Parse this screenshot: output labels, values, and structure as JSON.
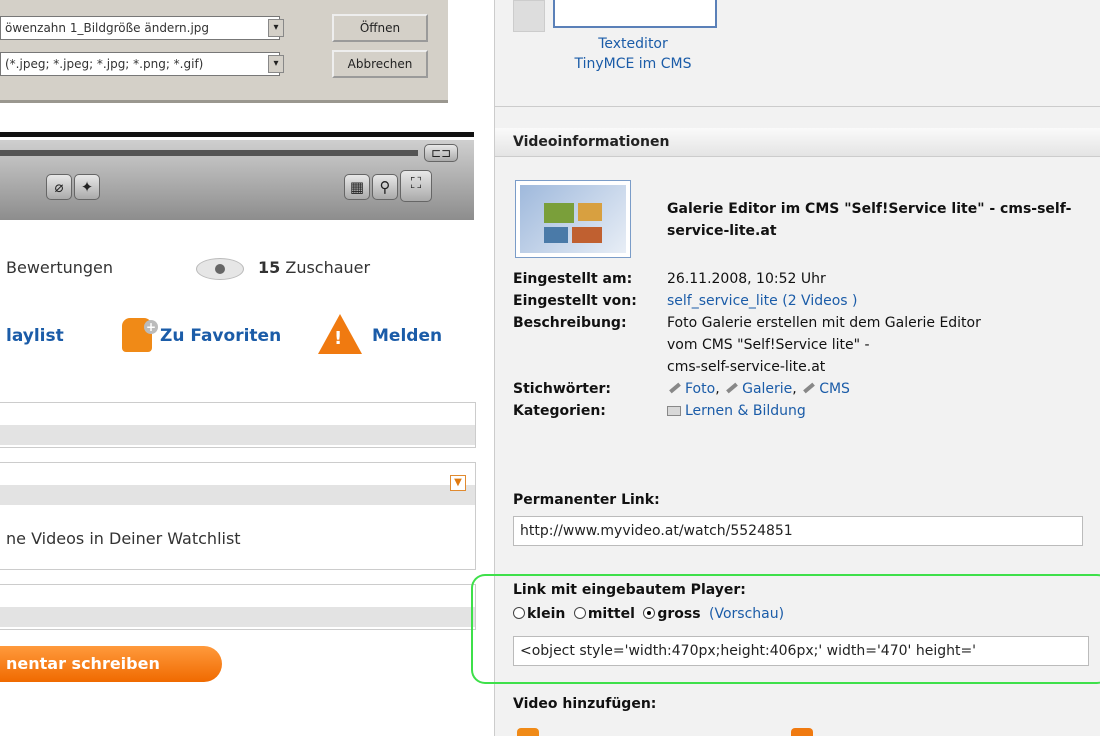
{
  "dialog": {
    "filename_value": "öwenzahn 1_Bildgröße ändern.jpg",
    "filetype_value": "(*.jpeg; *.jpeg; *.jpg; *.png; *.gif)",
    "open_label": "Öffnen",
    "cancel_label": "Abbrechen"
  },
  "stats": {
    "ratings_label": "Bewertungen",
    "viewers_count": "15",
    "viewers_label": "Zuschauer"
  },
  "actions": {
    "playlist_label": "laylist",
    "favorites_label": "Zu Favoriten",
    "report_label": "Melden"
  },
  "watchlist": {
    "text": "ne Videos in Deiner Watchlist"
  },
  "comment": {
    "button_label": "nentar schreiben"
  },
  "top_thumb": {
    "line1": "Texteditor",
    "line2": "TinyMCE im CMS"
  },
  "video_info": {
    "section_title": "Videoinformationen",
    "title": "Galerie Editor im CMS \"Self!Service lite\" - cms-self-service-lite.at",
    "posted_label": "Eingestellt am:",
    "posted_value": "26.11.2008, 10:52 Uhr",
    "by_label": "Eingestellt von:",
    "by_user": "self_service_lite",
    "by_count": "2 Videos",
    "desc_label": "Beschreibung:",
    "desc_line1": "Foto Galerie erstellen mit dem Galerie Editor",
    "desc_line2": "vom CMS \"Self!Service lite\" -",
    "desc_line3": "cms-self-service-lite.at",
    "tags_label": "Stichwörter:",
    "tags": [
      "Foto",
      "Galerie",
      "CMS"
    ],
    "cat_label": "Kategorien:",
    "cat_value": "Lernen & Bildung"
  },
  "permalink": {
    "label": "Permanenter Link:",
    "value": "http://www.myvideo.at/watch/5524851"
  },
  "embed": {
    "label": "Link mit eingebautem Player:",
    "size_small": "klein",
    "size_medium": "mittel",
    "size_large": "gross",
    "preview_label": "(Vorschau)",
    "code_value": "<object style='width:470px;height:406px;' width='470' height='"
  },
  "add_video": {
    "label": "Video hinzufügen:"
  }
}
